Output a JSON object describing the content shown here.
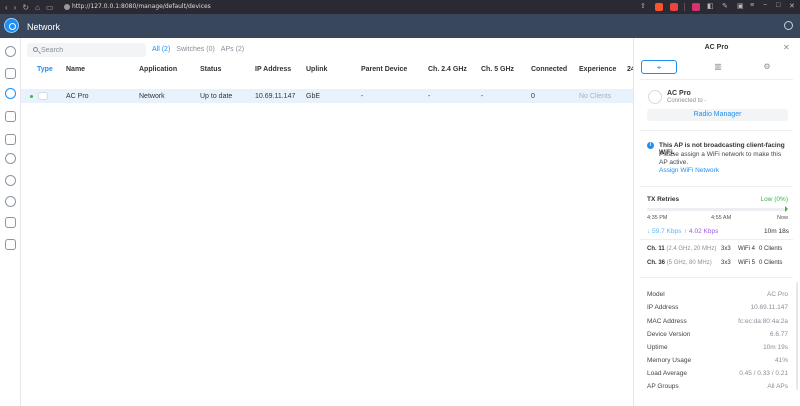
{
  "browser": {
    "url": "http://127.0.0.1:8080/manage/default/devices"
  },
  "app": {
    "title": "Network"
  },
  "sidebar": {
    "items": [
      {
        "name": "dashboard-icon"
      },
      {
        "name": "topology-icon"
      },
      {
        "name": "devices-icon"
      },
      {
        "name": "clients-icon"
      },
      {
        "name": "statistics-icon"
      },
      {
        "name": "shield-icon"
      },
      {
        "name": "insights-icon"
      },
      {
        "name": "settings-icon"
      },
      {
        "name": "reports-icon"
      },
      {
        "name": "events-icon"
      }
    ]
  },
  "search": {
    "placeholder": "Search"
  },
  "filters": {
    "all": "All (2)",
    "switches": "Switches (0)",
    "aps": "APs (2)"
  },
  "table": {
    "headers": [
      "Type",
      "Name",
      "Application",
      "Status",
      "IP Address",
      "Uplink",
      "Parent Device",
      "Ch. 2.4 GHz",
      "Ch. 5 GHz",
      "Connected",
      "Experience",
      "24"
    ],
    "rows": [
      {
        "name": "AC Pro",
        "application": "Network",
        "status": "Up to date",
        "ip": "10.69.11.147",
        "uplink": "GbE",
        "parent": "-",
        "ch24": "-",
        "ch5": "-",
        "connected": "0",
        "experience": "No Clients"
      }
    ]
  },
  "panel": {
    "title": "AC Pro",
    "tabs": [
      {
        "name": "tab-overview",
        "icon": "binoculars-icon",
        "glyph": "⌖"
      },
      {
        "name": "tab-insights",
        "icon": "bar-chart-icon",
        "glyph": "▥"
      },
      {
        "name": "tab-settings",
        "icon": "gear-icon",
        "glyph": "⚙"
      }
    ],
    "ap": {
      "name": "AC Pro",
      "connected_to": "Connected to -",
      "radio_manager": "Radio Manager"
    },
    "alert": {
      "title": "This AP is not broadcasting client-facing WiFi.",
      "text": "Please assign a WiFi network to make this AP active.",
      "link": "Assign WiFi Network"
    },
    "tx": {
      "label": "TX Retries",
      "value": "Low (0%)",
      "ticks": [
        "4:35 PM",
        "4:55 AM",
        "Now"
      ],
      "down": "↓ 59.7 Kbps",
      "up": "↑ 4.02 Kbps",
      "uptime_short": "10m 18s"
    },
    "channels": [
      {
        "ch": "Ch. 11",
        "band": "(2.4 GHz, 20 MHz)",
        "mimo": "3x3",
        "wifi": "WiFi 4",
        "clients": "0 Clients"
      },
      {
        "ch": "Ch. 36",
        "band": "(5 GHz, 80 MHz)",
        "mimo": "3x3",
        "wifi": "WiFi 5",
        "clients": "0 Clients"
      }
    ],
    "details": [
      {
        "label": "Model",
        "value": "AC Pro"
      },
      {
        "label": "IP Address",
        "value": "10.69.11.147"
      },
      {
        "label": "MAC Address",
        "value": "fc:ec:da:80:4a:2a"
      },
      {
        "label": "Device Version",
        "value": "6.6.77"
      },
      {
        "label": "Uptime",
        "value": "10m 19s"
      },
      {
        "label": "Memory Usage",
        "value": "41%"
      },
      {
        "label": "Load Average",
        "value": "0.45 / 0.33 / 0.21"
      },
      {
        "label": "AP Groups",
        "value": "All APs"
      }
    ]
  },
  "colors": {
    "accent": "#1d8ff2",
    "header": "#38475c",
    "success": "#3cb34b",
    "upload": "#9b59e6",
    "download": "#5ab7f5"
  }
}
